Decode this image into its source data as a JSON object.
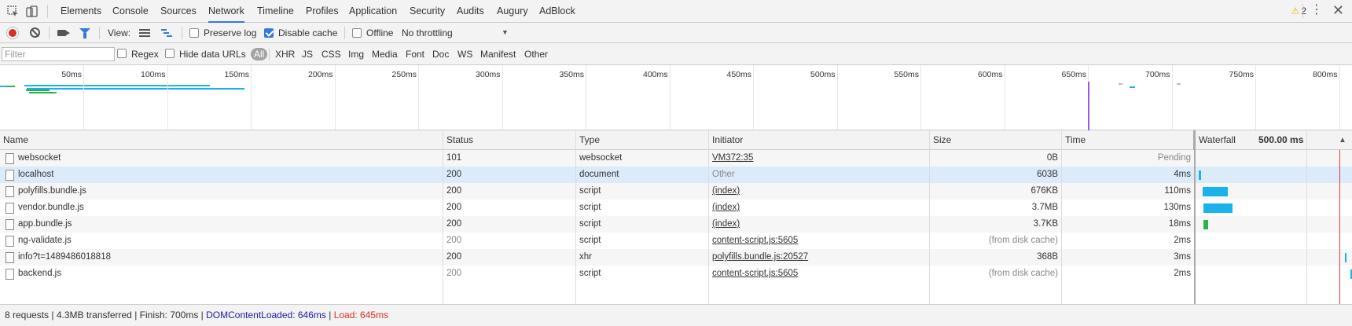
{
  "tabs": [
    {
      "label": "Elements"
    },
    {
      "label": "Console"
    },
    {
      "label": "Sources"
    },
    {
      "label": "Network"
    },
    {
      "label": "Timeline"
    },
    {
      "label": "Profiles"
    },
    {
      "label": "Application"
    },
    {
      "label": "Security"
    },
    {
      "label": "Audits"
    },
    {
      "label": "Augury"
    },
    {
      "label": "AdBlock"
    }
  ],
  "active_tab": "Network",
  "warning_count": "2",
  "toolbar": {
    "view_label": "View:",
    "preserve_log": "Preserve log",
    "preserve_log_checked": false,
    "disable_cache": "Disable cache",
    "disable_cache_checked": true,
    "offline": "Offline",
    "offline_checked": false,
    "throttling": "No throttling"
  },
  "filter": {
    "placeholder": "Filter",
    "regex": "Regex",
    "hide_data_urls": "Hide data URLs",
    "types": [
      "All",
      "XHR",
      "JS",
      "CSS",
      "Img",
      "Media",
      "Font",
      "Doc",
      "WS",
      "Manifest",
      "Other"
    ],
    "active_type": "All"
  },
  "overview_ticks": [
    "50ms",
    "100ms",
    "150ms",
    "200ms",
    "250ms",
    "300ms",
    "350ms",
    "400ms",
    "450ms",
    "500ms",
    "550ms",
    "600ms",
    "650ms",
    "700ms",
    "750ms",
    "800ms"
  ],
  "columns": {
    "name": "Name",
    "status": "Status",
    "type": "Type",
    "initiator": "Initiator",
    "size": "Size",
    "time": "Time",
    "waterfall": "Waterfall",
    "waterfall_scale": "500.00 ms"
  },
  "requests": [
    {
      "name": "websocket",
      "status": "101",
      "type": "websocket",
      "initiator": "VM372:35",
      "initiator_link": true,
      "size": "0B",
      "time": "Pending",
      "status_dim": false
    },
    {
      "name": "localhost",
      "status": "200",
      "type": "document",
      "initiator": "Other",
      "initiator_link": false,
      "size": "603B",
      "time": "4ms",
      "status_dim": false
    },
    {
      "name": "polyfills.bundle.js",
      "status": "200",
      "type": "script",
      "initiator": "(index)",
      "initiator_link": true,
      "size": "676KB",
      "time": "110ms",
      "status_dim": false
    },
    {
      "name": "vendor.bundle.js",
      "status": "200",
      "type": "script",
      "initiator": "(index)",
      "initiator_link": true,
      "size": "3.7MB",
      "time": "130ms",
      "status_dim": false
    },
    {
      "name": "app.bundle.js",
      "status": "200",
      "type": "script",
      "initiator": "(index)",
      "initiator_link": true,
      "size": "3.7KB",
      "time": "18ms",
      "status_dim": false
    },
    {
      "name": "ng-validate.js",
      "status": "200",
      "type": "script",
      "initiator": "content-script.js:5605",
      "initiator_link": true,
      "size": "(from disk cache)",
      "time": "2ms",
      "status_dim": true
    },
    {
      "name": "info?t=1489486018818",
      "status": "200",
      "type": "xhr",
      "initiator": "polyfills.bundle.js:20527",
      "initiator_link": true,
      "size": "368B",
      "time": "3ms",
      "status_dim": false
    },
    {
      "name": "backend.js",
      "status": "200",
      "type": "script",
      "initiator": "content-script.js:5605",
      "initiator_link": true,
      "size": "(from disk cache)",
      "time": "2ms",
      "status_dim": true
    }
  ],
  "status": {
    "summary": "8 requests | 4.3MB transferred | Finish: 700ms | ",
    "dom_content_loaded": "DOMContentLoaded: 646ms",
    "divider": " | ",
    "load": "Load: 645ms"
  },
  "colors": {
    "accent": "#3879d9",
    "waterfall_blue": "#1ab2ea",
    "waterfall_green": "#2bb24c",
    "dcl_blue": "#1a1aa6",
    "load_red": "#d93025"
  }
}
